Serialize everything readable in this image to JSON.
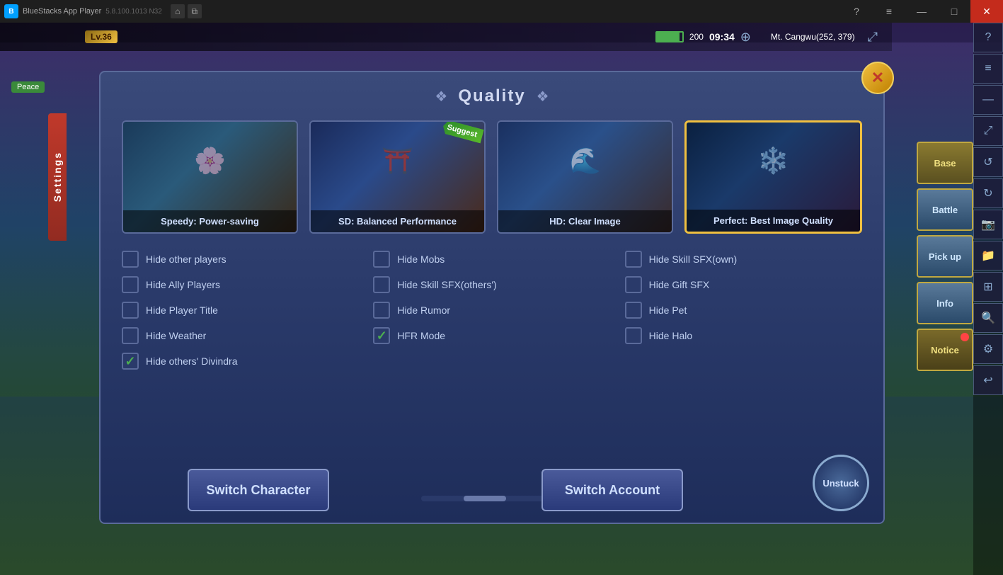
{
  "app": {
    "title": "BlueStacks App Player",
    "version": "5.8.100.1013  N32"
  },
  "titlebar": {
    "home_label": "⌂",
    "windows_label": "⧉",
    "help_label": "?",
    "menu_label": "≡",
    "minimize_label": "—",
    "maximize_label": "□",
    "close_label": "✕"
  },
  "game": {
    "level": "Lv.36",
    "battery": 200,
    "time": "09:34",
    "location": "Mt. Cangwu(252, 379)",
    "peace_label": "Peace"
  },
  "settings": {
    "tab_label": "Settings"
  },
  "quality": {
    "title": "Quality",
    "diamond_left": "❖",
    "diamond_right": "❖",
    "cards": [
      {
        "id": "speedy",
        "label": "Speedy: Power-saving",
        "selected": false,
        "suggest": false
      },
      {
        "id": "sd",
        "label": "SD: Balanced Performance",
        "selected": false,
        "suggest": true,
        "suggest_text": "Suggest"
      },
      {
        "id": "hd",
        "label": "HD: Clear Image",
        "selected": false,
        "suggest": false
      },
      {
        "id": "perfect",
        "label": "Perfect: Best Image Quality",
        "selected": true,
        "suggest": false
      }
    ]
  },
  "checkboxes": [
    {
      "id": "hide-other-players",
      "label": "Hide other players",
      "checked": false
    },
    {
      "id": "hide-mobs",
      "label": "Hide Mobs",
      "checked": false
    },
    {
      "id": "hide-skill-sfx-own",
      "label": "Hide Skill SFX(own)",
      "checked": false
    },
    {
      "id": "hide-ally-players",
      "label": "Hide Ally Players",
      "checked": false
    },
    {
      "id": "hide-skill-sfx-others",
      "label": "Hide Skill SFX(others')",
      "checked": false
    },
    {
      "id": "hide-gift-sfx",
      "label": "Hide Gift SFX",
      "checked": false
    },
    {
      "id": "hide-player-title",
      "label": "Hide Player Title",
      "checked": false
    },
    {
      "id": "hide-rumor",
      "label": "Hide Rumor",
      "checked": false
    },
    {
      "id": "hide-pet",
      "label": "Hide Pet",
      "checked": false
    },
    {
      "id": "hide-weather",
      "label": "Hide Weather",
      "checked": false
    },
    {
      "id": "hfr-mode",
      "label": "HFR Mode",
      "checked": true
    },
    {
      "id": "hide-halo",
      "label": "Hide Halo",
      "checked": false
    },
    {
      "id": "hide-others-divindra",
      "label": "Hide others' Divindra",
      "checked": true
    }
  ],
  "buttons": {
    "switch_character": "Switch Character",
    "switch_account": "Switch Account",
    "unstuck": "Unstuck",
    "close": "✕"
  },
  "side_panel": {
    "base": "Base",
    "battle": "Battle",
    "pickup": "Pick up",
    "info": "Info",
    "notice": "Notice"
  },
  "right_toolbar": {
    "icons": [
      "?",
      "≡",
      "—",
      "□",
      "✕",
      "⌂",
      "⚙",
      "↩",
      "↩"
    ]
  }
}
